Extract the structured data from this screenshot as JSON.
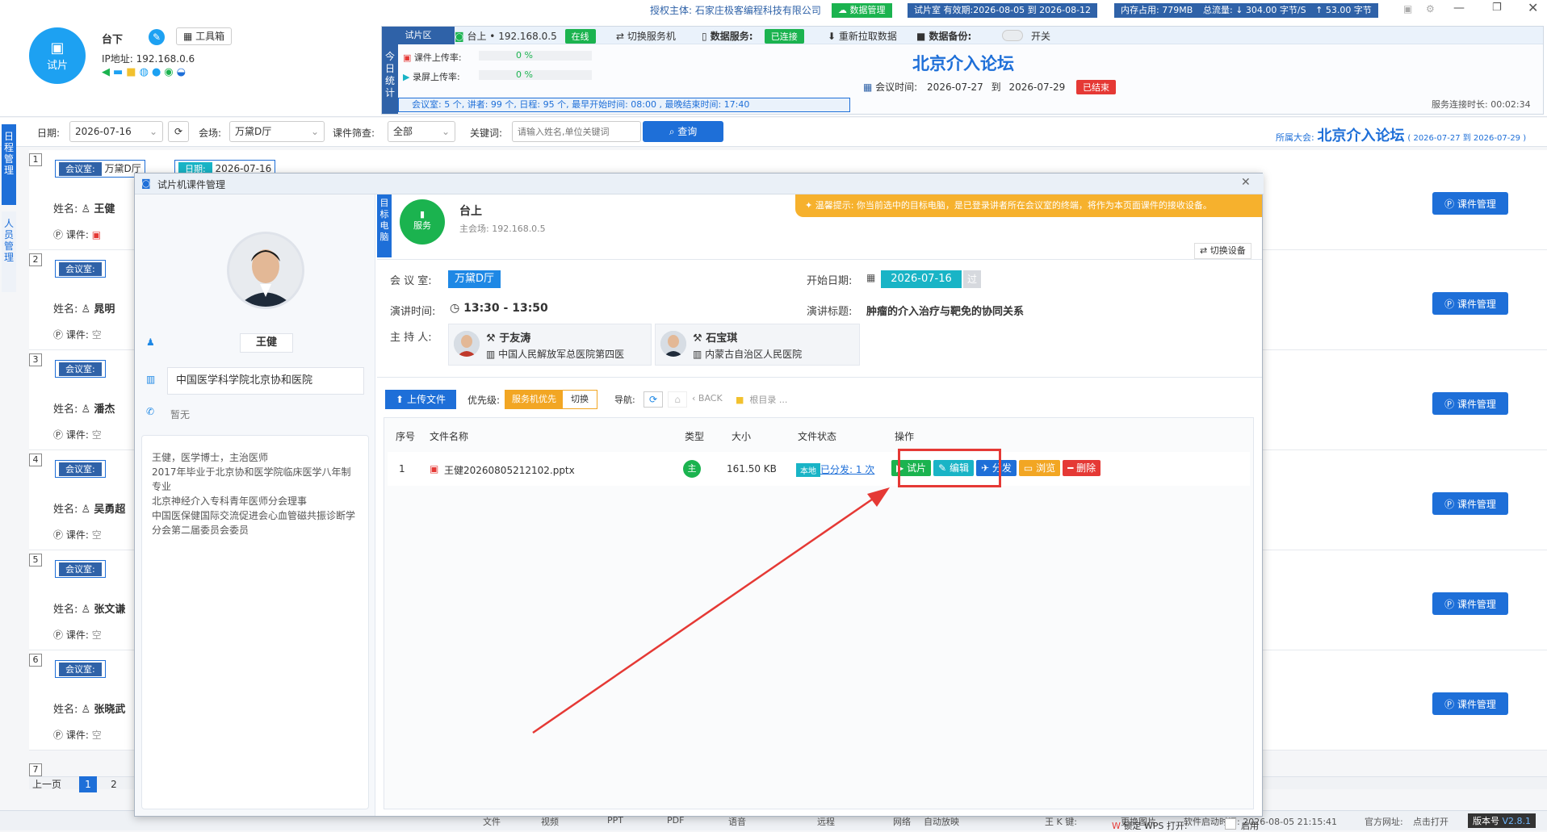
{
  "header": {
    "auth_label": "授权主体:",
    "auth_org": "石家庄极客编程科技有限公司",
    "data_mgmt": "数据管理",
    "room_validity": "试片室 有效期:2026-08-05 到 2026-08-12",
    "memory": "内存占用: 779MB",
    "traffic_label": "总流量:",
    "traffic_down": "↓ 304.00 字节/S",
    "traffic_up": "↑ 53.00 字节",
    "user": {
      "avatar_label": "试片",
      "name": "台下",
      "toolbox": "工具箱",
      "ip": "IP地址: 192.168.0.6"
    }
  },
  "trial": {
    "area_label": "试片区",
    "stage": "台上 • 192.168.0.5",
    "online": "在线",
    "switch_server": "切换服务机",
    "data_service": "数据服务:",
    "connected": "已连接",
    "repull": "重新拉取数据",
    "backup": "数据备份:",
    "switch": "开关",
    "today_stats": "今日统计",
    "course_upload": "课件上传率:",
    "course_pct": "0 %",
    "record_upload": "录屏上传率:",
    "record_pct": "0 %",
    "summary": "会议室: 5 个,  讲者: 99 个,  日程: 95 个,  最早开始时间: 08:00 ,   最晚结束时间: 17:40",
    "forum_title": "北京介入论坛",
    "meeting_time_label": "会议时间:",
    "meeting_from": "2026-07-27",
    "to_label": "到",
    "meeting_to": "2026-07-29",
    "ended": "已结束",
    "service_uptime": "服务连接时长: 00:02:34"
  },
  "filters": {
    "date_label": "日期:",
    "date_value": "2026-07-16",
    "venue_label": "会场:",
    "venue_value": "万黛D厅",
    "course_filter_label": "课件筛查:",
    "course_filter_value": "全部",
    "keyword_label": "关键词:",
    "keyword_placeholder": "请输入姓名,单位关键词",
    "search_btn": "查询",
    "meeting_label": "所属大会:",
    "meeting_name": "北京介入论坛",
    "meeting_range": "( 2026-07-27 到 2026-07-29 )"
  },
  "side_tabs": {
    "schedule": "日程管理",
    "people": "人员管理"
  },
  "list": {
    "room_label": "会议室:",
    "room_value": "万黛D厅",
    "date_label": "日期:",
    "date_value": "2026-07-16",
    "name_label": "姓名:",
    "course_label": "课件:",
    "empty": "空",
    "mgmt_btn": "课件管理",
    "rows": [
      {
        "num": "1",
        "name": "王健"
      },
      {
        "num": "2",
        "name": "晁明"
      },
      {
        "num": "3",
        "name": "潘杰"
      },
      {
        "num": "4",
        "name": "吴勇超"
      },
      {
        "num": "5",
        "name": "张文谦"
      },
      {
        "num": "6",
        "name": "张晓武"
      },
      {
        "num": "7",
        "name": ""
      }
    ],
    "prev_page": "上一页",
    "page1": "1",
    "page2": "2"
  },
  "modal": {
    "title": "试片机课件管理",
    "speaker": {
      "name": "王健",
      "org": "中国医学科学院北京协和医院",
      "phone": "暂无",
      "bio": "王健，医学博士，主治医师\n2017年毕业于北京协和医学院临床医学八年制专业\n北京神经介入专科青年医师分会理事\n中国医保健国际交流促进会心血管磁共振诊断学分会第二届委员会委员"
    },
    "target_label": "目标电脑",
    "target_icon_label": "服务",
    "target_name": "台上",
    "target_main": "主会场: 192.168.0.5",
    "tip": "温馨提示: 你当前选中的目标电脑，是已登录讲者所在会议室的终端，将作为本页面课件的接收设备。",
    "switch_device": "切换设备",
    "room_label": "会 议 室:",
    "room_value": "万黛D厅",
    "start_label": "开始日期:",
    "start_value": "2026-07-16",
    "passed": "过",
    "time_label": "演讲时间:",
    "time_value": "13:30 - 13:50",
    "topic_label": "演讲标题:",
    "topic_value": "肿瘤的介入治疗与靶免的协同关系",
    "host_label": "主 持 人:",
    "hosts": [
      {
        "name": "于友涛",
        "org": "中国人民解放军总医院第四医"
      },
      {
        "name": "石宝琪",
        "org": "内蒙古自治区人民医院"
      }
    ],
    "upload_btn": "上传文件",
    "priority_label": "优先级:",
    "priority_value": "服务机优先",
    "priority_switch": "切换",
    "nav_label": "导航:",
    "back": "BACK",
    "root": "根目录 ...",
    "columns": [
      "序号",
      "文件名称",
      "类型",
      "大小",
      "文件状态",
      "操作"
    ],
    "files": [
      {
        "num": "1",
        "name": "王健20260805212102.pptx",
        "type": "主",
        "size": "161.50 KB",
        "local": "本地",
        "status": "已分发: 1 次"
      }
    ],
    "ops": {
      "trial": "试片",
      "edit": "编辑",
      "distribute": "分发",
      "browse": "浏览",
      "delete": "删除"
    },
    "wps_lock": "锁定 WPS 打开:",
    "enable": "启用"
  },
  "footer": {
    "file": "文件",
    "video": "视频",
    "ppt": "PPT",
    "pdf": "PDF",
    "audio": "语音",
    "remote": "远程",
    "network": "网络",
    "auto_ppt": "自动放映",
    "k_key": "王 K 键:",
    "change_pic": "更换图片",
    "launch_time": "软件启动时间: 2026-08-05 21:15:41",
    "website": "官方网址:",
    "click_open": "点击打开",
    "version_label": "版本号",
    "version": "V2.8.1"
  },
  "colors": {
    "primary": "#1e6fd8",
    "success": "#1bb34f",
    "danger": "#e53935",
    "tip_bg": "#f6b12d",
    "annotation": "#e53935"
  }
}
